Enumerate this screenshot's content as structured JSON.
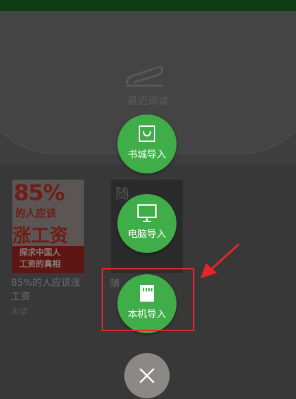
{
  "shelf": {
    "recent_label": "最近阅读"
  },
  "books": [
    {
      "cover_big": "85%",
      "cover_mid": "的人应该",
      "cover_main": "涨工资",
      "cover_band": [
        "探求中国人",
        "工资的真相"
      ],
      "title": "85%的人应该涨工资",
      "author": "未读"
    },
    {
      "cover_glyph": "随",
      "title": "随"
    }
  ],
  "actions": {
    "store_import": "书城导入",
    "pc_import": "电脑导入",
    "local_import": "本机导入"
  },
  "colors": {
    "button_green": "#3fae49",
    "highlight_red": "#e8242b",
    "close_gray": "#8a8985"
  },
  "icons": {
    "store": "shopping-bag-icon",
    "pc": "monitor-icon",
    "local": "sd-card-icon",
    "close": "close-icon"
  }
}
